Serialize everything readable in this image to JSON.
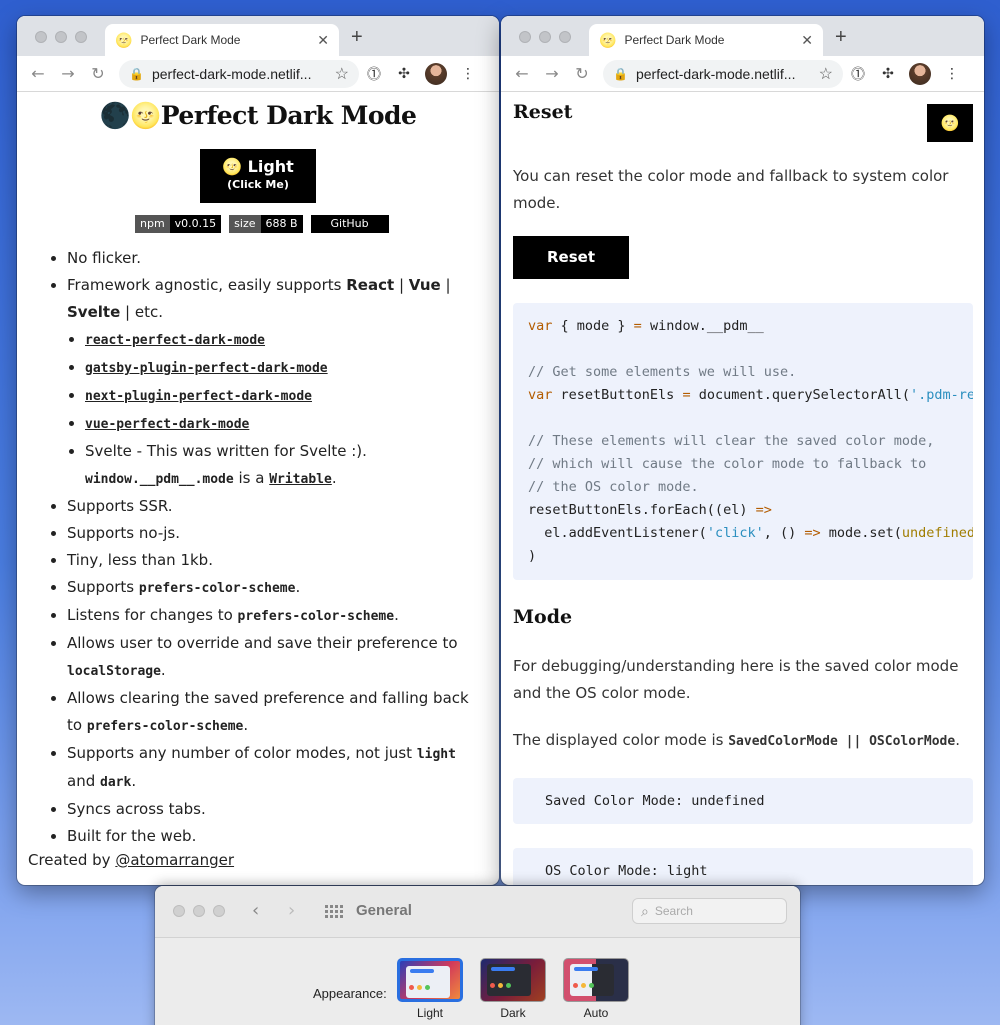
{
  "left_window": {
    "tab_title": "Perfect Dark Mode",
    "url": "perfect-dark-mode.netlif...",
    "page": {
      "title": "Perfect Dark Mode",
      "title_emoji": "🌑🌝",
      "toggle_label": "Light",
      "toggle_emoji": "🌝",
      "toggle_sublabel": "(Click Me)",
      "badges": [
        {
          "key": "npm",
          "value": "v0.0.15"
        },
        {
          "key": "size",
          "value": "688 B"
        }
      ],
      "github_label": "GitHub",
      "features": {
        "no_flicker": "No flicker.",
        "framework_pre": "Framework agnostic, easily supports ",
        "react": "React",
        "sep1": " | ",
        "vue": "Vue",
        "sep2": " |",
        "svelte": "Svelte",
        "etc": " | etc.",
        "packages": [
          "react-perfect-dark-mode",
          "gatsby-plugin-perfect-dark-mode",
          "next-plugin-perfect-dark-mode",
          "vue-perfect-dark-mode"
        ],
        "svelte_note": "Svelte - This was written for Svelte :).",
        "svelte_code": "window.__pdm__.mode",
        "svelte_is": " is a ",
        "svelte_writable": "Writable",
        "svelte_dot": ".",
        "ssr": "Supports SSR.",
        "nojs": "Supports no-js.",
        "tiny": "Tiny, less than 1kb.",
        "pcs_pre": "Supports ",
        "pcs_code": "prefers-color-scheme",
        "pcs_dot": ".",
        "listen_pre": "Listens for changes to ",
        "listen_code": "prefers-color-scheme",
        "listen_dot": ".",
        "override_pre": "Allows user to override and save their preference to ",
        "override_code": "localStorage",
        "override_dot": ".",
        "clear_pre": "Allows clearing the saved preference and falling back to ",
        "clear_code": "prefers-color-scheme",
        "clear_dot": ".",
        "modes_pre": "Supports any number of color modes, not just ",
        "modes_light": "light",
        "modes_and": " and ",
        "modes_dark": "dark",
        "modes_dot": ".",
        "sync": "Syncs across tabs.",
        "web": "Built for the web."
      },
      "created_by_pre": "Created by ",
      "created_by_link": "@atomarranger"
    }
  },
  "right_window": {
    "tab_title": "Perfect Dark Mode",
    "url": "perfect-dark-mode.netlif...",
    "page": {
      "reset_heading": "Reset",
      "floating_toggle_emoji": "🌝",
      "reset_desc": "You can reset the color mode and fallback to system color mode.",
      "reset_button": "Reset",
      "code": {
        "l1_kw": "var",
        "l1_rest": " { mode } ",
        "l1_eq": "=",
        "l1_end": " window.__pdm__",
        "l3": "// Get some elements we will use.",
        "l4_kw": "var",
        "l4_rest": " resetButtonEls ",
        "l4_eq": "=",
        "l4_mid": " document.querySelectorAll(",
        "l4_str": "'.pdm-re",
        "l6": "// These elements will clear the saved color mode,",
        "l7": "// which will cause the color mode to fallback to",
        "l8": "// the OS color mode.",
        "l9_a": "resetButtonEls.forEach((el) ",
        "l9_arrow": "=>",
        "l10_a": "  el.addEventListener(",
        "l10_str": "'click'",
        "l10_b": ", () ",
        "l10_arrow": "=>",
        "l10_c": " mode.set(",
        "l10_u": "undefined",
        "l11": ")"
      },
      "mode_heading": "Mode",
      "mode_desc": "For debugging/understanding here is the saved color mode and the OS color mode.",
      "displayed_pre": "The displayed color mode is ",
      "displayed_code": "SavedColorMode || OSColorMode",
      "displayed_dot": ".",
      "saved_mode": "Saved Color Mode: undefined",
      "os_mode": "OS Color Mode: light"
    }
  },
  "system_prefs": {
    "title": "General",
    "search_placeholder": "Search",
    "appearance_label": "Appearance:",
    "options": [
      {
        "label": "Light",
        "selected": true
      },
      {
        "label": "Dark",
        "selected": false
      },
      {
        "label": "Auto",
        "selected": false
      }
    ]
  }
}
